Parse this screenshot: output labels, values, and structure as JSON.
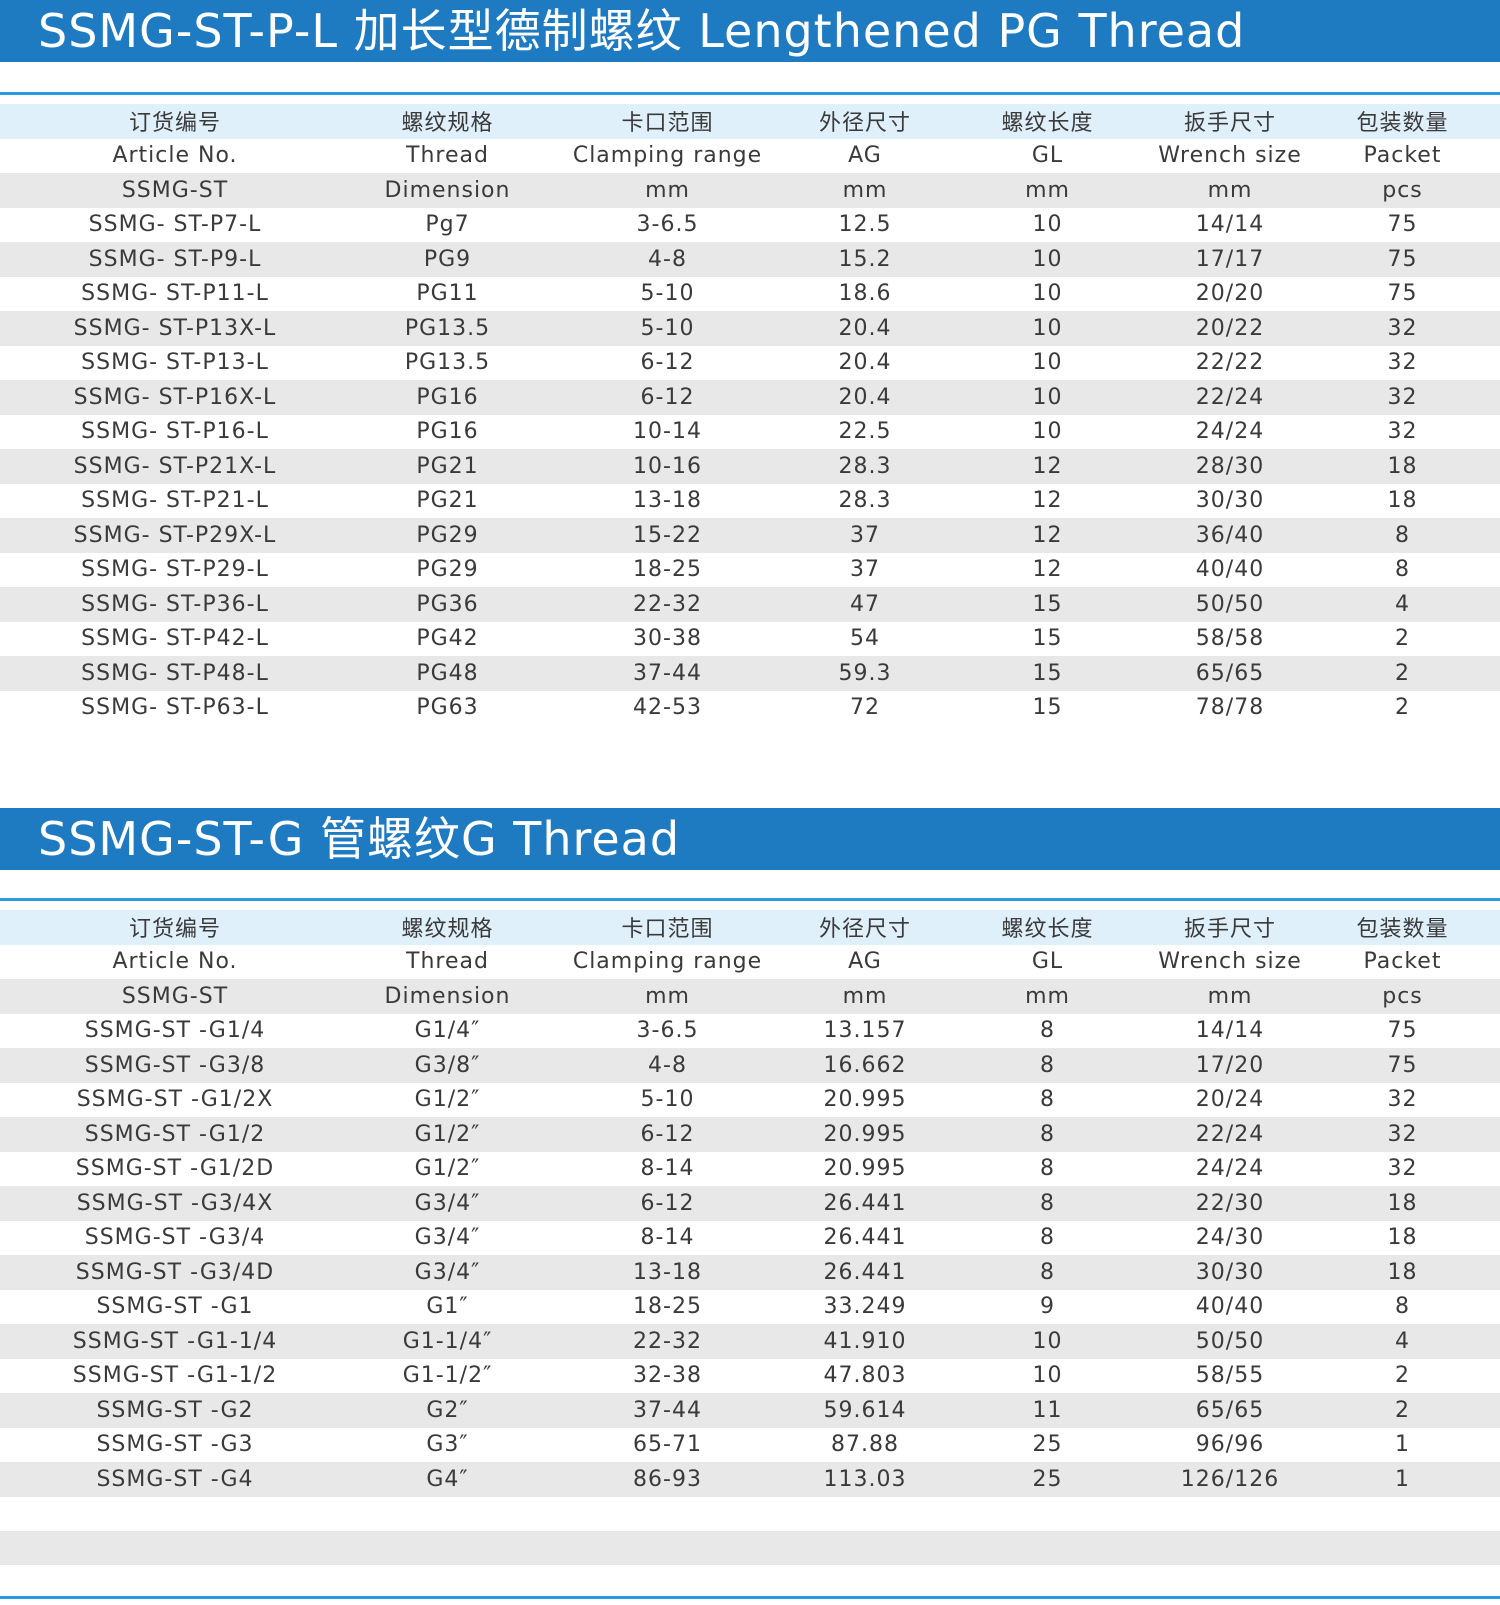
{
  "columns": {
    "zh": [
      "订货编号",
      "螺纹规格",
      "卡口范围",
      "外径尺寸",
      "螺纹长度",
      "扳手尺寸",
      "包装数量"
    ],
    "en": [
      "Article No.",
      "Thread",
      "Clamping range",
      "AG",
      "GL",
      "Wrench size",
      "Packet"
    ],
    "units": [
      "SSMG-ST",
      "Dimension",
      "mm",
      "mm",
      "mm",
      "mm",
      "pcs"
    ]
  },
  "pg_section": {
    "title": "SSMG-ST-P-L 加长型德制螺纹 Lengthened PG Thread",
    "rows": [
      [
        "SSMG- ST-P7-L",
        "Pg7",
        "3-6.5",
        "12.5",
        "10",
        "14/14",
        "75"
      ],
      [
        "SSMG- ST-P9-L",
        "PG9",
        "4-8",
        "15.2",
        "10",
        "17/17",
        "75"
      ],
      [
        "SSMG- ST-P11-L",
        "PG11",
        "5-10",
        "18.6",
        "10",
        "20/20",
        "75"
      ],
      [
        "SSMG- ST-P13X-L",
        "PG13.5",
        "5-10",
        "20.4",
        "10",
        "20/22",
        "32"
      ],
      [
        "SSMG- ST-P13-L",
        "PG13.5",
        "6-12",
        "20.4",
        "10",
        "22/22",
        "32"
      ],
      [
        "SSMG- ST-P16X-L",
        "PG16",
        "6-12",
        "20.4",
        "10",
        "22/24",
        "32"
      ],
      [
        "SSMG- ST-P16-L",
        "PG16",
        "10-14",
        "22.5",
        "10",
        "24/24",
        "32"
      ],
      [
        "SSMG- ST-P21X-L",
        "PG21",
        "10-16",
        "28.3",
        "12",
        "28/30",
        "18"
      ],
      [
        "SSMG- ST-P21-L",
        "PG21",
        "13-18",
        "28.3",
        "12",
        "30/30",
        "18"
      ],
      [
        "SSMG- ST-P29X-L",
        "PG29",
        "15-22",
        "37",
        "12",
        "36/40",
        "8"
      ],
      [
        "SSMG- ST-P29-L",
        "PG29",
        "18-25",
        "37",
        "12",
        "40/40",
        "8"
      ],
      [
        "SSMG- ST-P36-L",
        "PG36",
        "22-32",
        "47",
        "15",
        "50/50",
        "4"
      ],
      [
        "SSMG- ST-P42-L",
        "PG42",
        "30-38",
        "54",
        "15",
        "58/58",
        "2"
      ],
      [
        "SSMG- ST-P48-L",
        "PG48",
        "37-44",
        "59.3",
        "15",
        "65/65",
        "2"
      ],
      [
        "SSMG- ST-P63-L",
        "PG63",
        "42-53",
        "72",
        "15",
        "78/78",
        "2"
      ]
    ]
  },
  "g_section": {
    "title": "SSMG-ST-G 管螺纹G Thread",
    "rows": [
      [
        "SSMG-ST -G1/4",
        "G1/4″",
        "3-6.5",
        "13.157",
        "8",
        "14/14",
        "75"
      ],
      [
        "SSMG-ST -G3/8",
        "G3/8″",
        "4-8",
        "16.662",
        "8",
        "17/20",
        "75"
      ],
      [
        "SSMG-ST -G1/2X",
        "G1/2″",
        "5-10",
        "20.995",
        "8",
        "20/24",
        "32"
      ],
      [
        "SSMG-ST -G1/2",
        "G1/2″",
        "6-12",
        "20.995",
        "8",
        "22/24",
        "32"
      ],
      [
        "SSMG-ST -G1/2D",
        "G1/2″",
        "8-14",
        "20.995",
        "8",
        "24/24",
        "32"
      ],
      [
        "SSMG-ST -G3/4X",
        "G3/4″",
        "6-12",
        "26.441",
        "8",
        "22/30",
        "18"
      ],
      [
        "SSMG-ST -G3/4",
        "G3/4″",
        "8-14",
        "26.441",
        "8",
        "24/30",
        "18"
      ],
      [
        "SSMG-ST -G3/4D",
        "G3/4″",
        "13-18",
        "26.441",
        "8",
        "30/30",
        "18"
      ],
      [
        "SSMG-ST -G1",
        "G1″",
        "18-25",
        "33.249",
        "9",
        "40/40",
        "8"
      ],
      [
        "SSMG-ST -G1-1/4",
        "G1-1/4″",
        "22-32",
        "41.910",
        "10",
        "50/50",
        "4"
      ],
      [
        "SSMG-ST -G1-1/2",
        "G1-1/2″",
        "32-38",
        "47.803",
        "10",
        "58/55",
        "2"
      ],
      [
        "SSMG-ST -G2",
        "G2″",
        "37-44",
        "59.614",
        "11",
        "65/65",
        "2"
      ],
      [
        "SSMG-ST -G3",
        "G3″",
        "65-71",
        "87.88",
        "25",
        "96/96",
        "1"
      ],
      [
        "SSMG-ST -G4",
        "G4″",
        "86-93",
        "113.03",
        "25",
        "126/126",
        "1"
      ]
    ]
  }
}
